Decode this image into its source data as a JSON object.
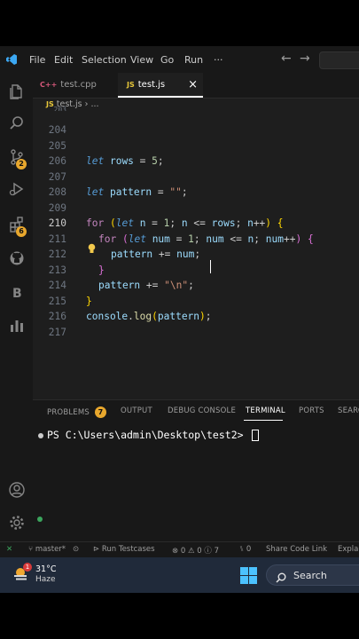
{
  "menu": [
    "File",
    "Edit",
    "Selection",
    "View",
    "Go",
    "Run",
    "···"
  ],
  "nav": {
    "back": "←",
    "forward": "→"
  },
  "tabs": [
    {
      "icon": "C++",
      "label": "test.cpp",
      "active": false
    },
    {
      "icon": "JS",
      "label": "test.js",
      "active": true,
      "close": "×"
    }
  ],
  "breadcrumb": {
    "icon": "JS",
    "file": "test.js",
    "rest": "› ..."
  },
  "activity_badges": {
    "source_control": "2",
    "extensions": "6"
  },
  "editor": {
    "line_numbers": [
      "204",
      "205",
      "206",
      "207",
      "208",
      "209",
      "210",
      "211",
      "212",
      "213",
      "214",
      "215",
      "216",
      "217"
    ],
    "top_partial": "203",
    "tokens": {
      "let": "let",
      "for": "for",
      "rows": "rows",
      "eq": " = ",
      "five": "5",
      "semi": ";",
      "pattern": "pattern",
      "empty_str": "\"\"",
      "n": "n",
      "one": "1",
      "le": " <= ",
      "inc": "++",
      "num": "num",
      "plus_eq": " += ",
      "newline_str": "\"\\n\"",
      "console": "console",
      "log": "log"
    }
  },
  "panel": {
    "tabs": [
      "PROBLEMS",
      "OUTPUT",
      "DEBUG CONSOLE",
      "TERMINAL",
      "PORTS",
      "SEARCH"
    ],
    "problems_count": "7",
    "prompt": "PS C:\\Users\\admin\\Desktop\\test2> "
  },
  "status": {
    "branch": "master*",
    "testcases": "Run Testcases",
    "errors": "0",
    "warnings": "0",
    "info": "7",
    "ports": "0",
    "share": "Share Code Link",
    "explain": "Explain"
  },
  "taskbar": {
    "temperature": "31°C",
    "weather": "Haze",
    "weather_badge": "1",
    "search": "Search"
  },
  "colors": {
    "background": "#1e1e1e",
    "keyword": "#c586c0",
    "declaration": "#569cd6",
    "variable": "#9cdcfe",
    "number": "#b5cea8",
    "string": "#ce9178",
    "function": "#dcdcaa",
    "accent_blue": "#3ca8f3",
    "badge": "#e8a72d"
  }
}
